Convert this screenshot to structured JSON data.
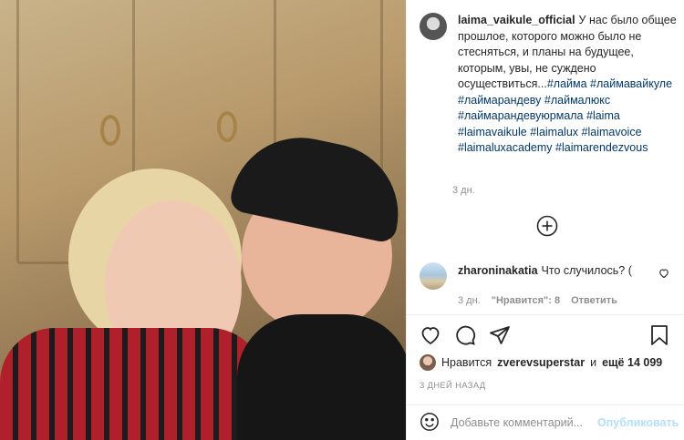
{
  "post": {
    "username": "laima_vaikule_official",
    "caption_text": "У нас было общее прошлое, которого можно было не стесняться, и планы на будущее, которым, увы, не суждено осуществиться...",
    "hashtags": [
      "#лайма",
      "#лаймавайкуле",
      "#лаймарандеву",
      "#лаймалюкс",
      "#лаймарандевуюрмала",
      "#laima",
      "#laimavaikule",
      "#laimalux",
      "#laimavoice",
      "#laimaluxacademy",
      "#laimarendezvous"
    ],
    "caption_time": "3 дн."
  },
  "comment": {
    "username": "zharoninakatia",
    "text": "Что случилось? (",
    "time": "3 дн.",
    "likes": "\"Нравится\": 8",
    "reply": "Ответить"
  },
  "likes": {
    "prefix": "Нравится",
    "user": "zverevsuperstar",
    "middle": "и",
    "count": "ещё 14 099"
  },
  "date": "3 ДНЕЙ НАЗАД",
  "add_comment": {
    "placeholder": "Добавьте комментарий...",
    "publish": "Опубликовать"
  },
  "icons": {
    "plus": "plus-circle-icon",
    "heart": "heart-icon",
    "comment": "comment-icon",
    "share": "send-icon",
    "save": "bookmark-icon",
    "emoji": "emoji-icon"
  },
  "colors": {
    "hashtag": "#00376b",
    "muted": "#8e8e8e",
    "publish": "#b2dffc"
  }
}
